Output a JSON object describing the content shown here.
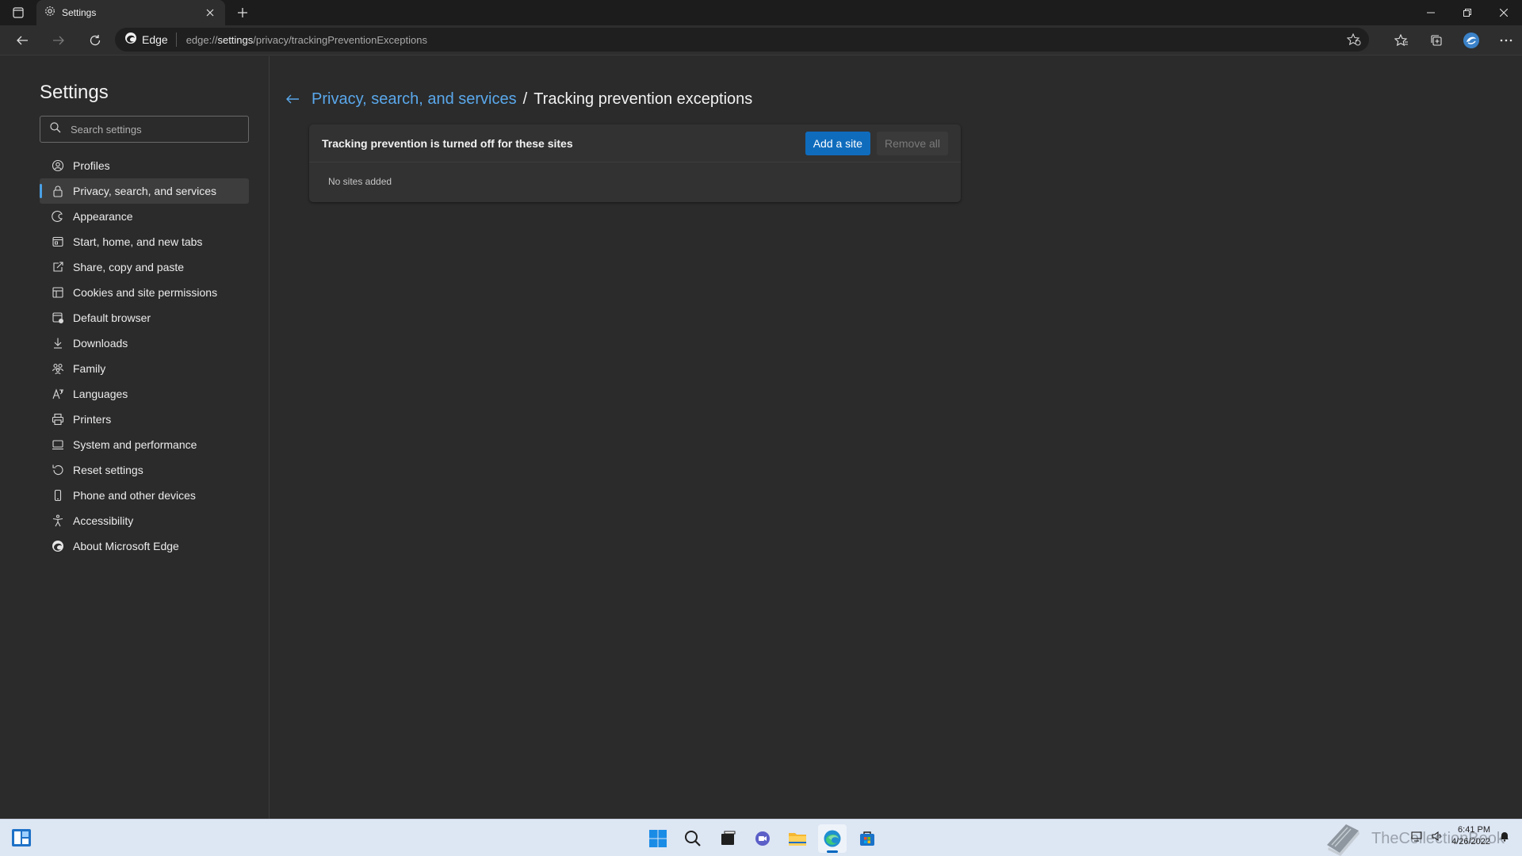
{
  "browser": {
    "tab_title": "Settings",
    "site_chip_label": "Edge",
    "url_prefix": "edge://",
    "url_host": "settings",
    "url_path": "/privacy/trackingPreventionExceptions"
  },
  "sidebar": {
    "title": "Settings",
    "search_placeholder": "Search settings",
    "items": [
      {
        "label": "Profiles",
        "icon": "profile-icon"
      },
      {
        "label": "Privacy, search, and services",
        "icon": "lock-icon",
        "active": true
      },
      {
        "label": "Appearance",
        "icon": "appearance-icon"
      },
      {
        "label": "Start, home, and new tabs",
        "icon": "home-tabs-icon"
      },
      {
        "label": "Share, copy and paste",
        "icon": "share-icon"
      },
      {
        "label": "Cookies and site permissions",
        "icon": "cookies-icon"
      },
      {
        "label": "Default browser",
        "icon": "default-browser-icon"
      },
      {
        "label": "Downloads",
        "icon": "download-icon"
      },
      {
        "label": "Family",
        "icon": "family-icon"
      },
      {
        "label": "Languages",
        "icon": "languages-icon"
      },
      {
        "label": "Printers",
        "icon": "printer-icon"
      },
      {
        "label": "System and performance",
        "icon": "system-icon"
      },
      {
        "label": "Reset settings",
        "icon": "reset-icon"
      },
      {
        "label": "Phone and other devices",
        "icon": "phone-icon"
      },
      {
        "label": "Accessibility",
        "icon": "accessibility-icon"
      },
      {
        "label": "About Microsoft Edge",
        "icon": "edge-logo-icon"
      }
    ]
  },
  "content": {
    "breadcrumb_parent": "Privacy, search, and services",
    "breadcrumb_separator": "/",
    "breadcrumb_current": "Tracking prevention exceptions",
    "card_title": "Tracking prevention is turned off for these sites",
    "add_button": "Add a site",
    "remove_all_button": "Remove all",
    "empty_text": "No sites added"
  },
  "taskbar": {
    "watermark": "TheCollectionBook",
    "time": "6:41 PM",
    "date": "4/26/2022"
  },
  "colors": {
    "accent": "#0f6cbd",
    "link": "#5aa8ec",
    "background": "#2b2b2b"
  }
}
